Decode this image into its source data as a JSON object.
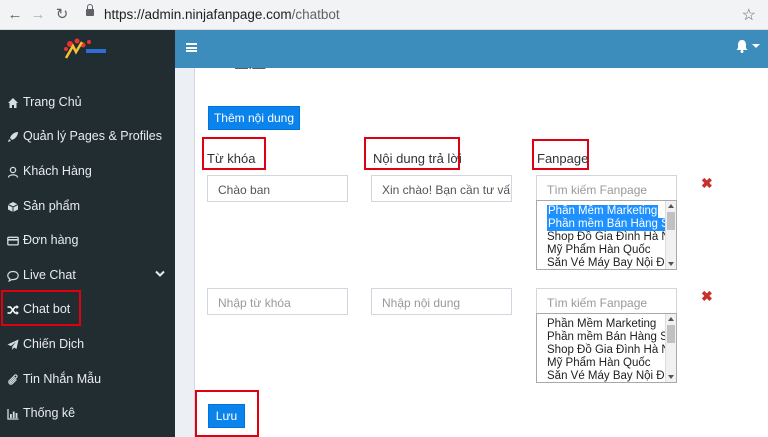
{
  "browser": {
    "url_host": "https://admin.ninjafanpage.com",
    "url_path": "/chatbot"
  },
  "sidebar": {
    "items": [
      {
        "label": "Trang Chủ",
        "icon": "home-icon"
      },
      {
        "label": "Quản lý Pages & Profiles",
        "icon": "rocket-icon"
      },
      {
        "label": "Khách Hàng",
        "icon": "user-icon"
      },
      {
        "label": "Sản phẩm",
        "icon": "cube-icon"
      },
      {
        "label": "Đơn hàng",
        "icon": "credit-card-icon"
      },
      {
        "label": "Live Chat",
        "icon": "chat-icon",
        "has_submenu": true
      },
      {
        "label": "Chat bot",
        "icon": "random-icon"
      },
      {
        "label": "Chiến Dịch",
        "icon": "paper-plane-icon"
      },
      {
        "label": "Tin Nhắn Mẫu",
        "icon": "paperclip-icon"
      },
      {
        "label": "Thống kê",
        "icon": "bar-chart-icon"
      }
    ]
  },
  "content": {
    "add_button": "Thêm nội dung",
    "save_button": "Lưu",
    "columns": {
      "keyword": "Từ khóa",
      "reply": "Nội dung trả lời",
      "fanpage": "Fanpage"
    },
    "rows": [
      {
        "keyword_value": "Chào ban",
        "keyword_placeholder": "Nhập từ khóa",
        "reply_value": "Xin chào! Bạn cần tư vấn",
        "reply_placeholder": "Nhập nội dung",
        "search_placeholder": "Tìm kiếm Fanpage",
        "options": [
          "Phần Mềm Marketing",
          "Phần mềm Bán Hàng S",
          "Shop Đồ Gia Đình Hà N",
          "Mỹ Phẩm Hàn Quốc",
          "Săn Vé Máy Bay Nội Đị"
        ],
        "selected": [
          0,
          1
        ]
      },
      {
        "keyword_value": "",
        "keyword_placeholder": "Nhập từ khóa",
        "reply_value": "",
        "reply_placeholder": "Nhập nội dung",
        "search_placeholder": "Tìm kiếm Fanpage",
        "options": [
          "Phần Mềm Marketing",
          "Phần mềm Bán Hàng S",
          "Shop Đồ Gia Đình Hà N",
          "Mỹ Phẩm Hàn Quốc",
          "Săn Vé Máy Bay Nội Đị"
        ],
        "selected": []
      }
    ]
  },
  "colors": {
    "sidebar": "#222d32",
    "topbar": "#3c8dbc",
    "primary_button": "#0a84ec",
    "highlight_border": "#e00012",
    "remove": "#c9302c"
  }
}
